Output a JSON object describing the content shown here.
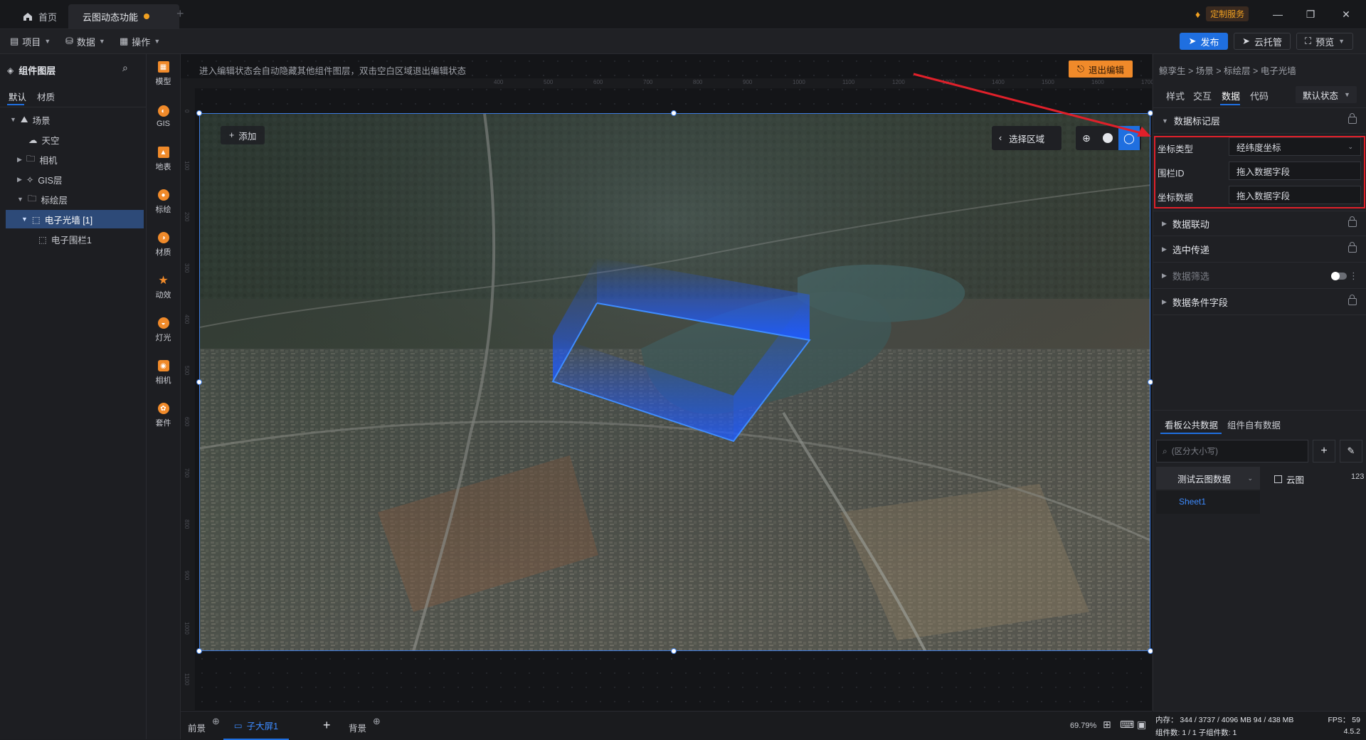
{
  "tabs": {
    "home": "首页",
    "current": "云图动态功能"
  },
  "premium": {
    "label": "定制服务"
  },
  "menu": {
    "project": "项目",
    "data": "数据",
    "operate": "操作"
  },
  "toolbar": {
    "publish": "发布",
    "cloud_host": "云托管",
    "preview": "预览"
  },
  "layers": {
    "title": "组件图层",
    "tabs": [
      "默认",
      "材质"
    ],
    "tree": [
      {
        "label": "场景"
      },
      {
        "label": "天空"
      },
      {
        "label": "相机"
      },
      {
        "label": "GIS层"
      },
      {
        "label": "标绘层"
      },
      {
        "label": "电子光墙 [1]"
      },
      {
        "label": "电子围栏1"
      }
    ]
  },
  "tools": [
    "模型",
    "GIS",
    "地表",
    "标绘",
    "材质",
    "动效",
    "灯光",
    "相机",
    "套件"
  ],
  "canvas": {
    "notice": "进入编辑状态会自动隐藏其他组件图层，双击空白区域退出编辑状态",
    "exit_edit": "退出编辑",
    "add": "添加",
    "select_area": "选择区域",
    "ruler_top": [
      "400",
      "500",
      "600",
      "700",
      "800",
      "900",
      "1000",
      "1100",
      "1200",
      "1300",
      "1400",
      "1500",
      "1600",
      "1700",
      "1800",
      "1900"
    ],
    "ruler_left": [
      "0",
      "100",
      "200",
      "300",
      "400",
      "500",
      "600",
      "700",
      "800",
      "900",
      "1000",
      "1100"
    ]
  },
  "props": {
    "breadcrumb": "鲸孪生 > 场景 > 标绘层 > 电子光墙",
    "tabs": [
      "样式",
      "交互",
      "数据",
      "代码"
    ],
    "state_select": "默认状态",
    "sections": {
      "data_markup": "数据标记层",
      "data_link": "数据联动",
      "selected_pass": "选中传递",
      "data_filter": "数据筛选",
      "data_condition": "数据条件字段"
    },
    "fields": [
      {
        "label": "坐标类型",
        "value": "经纬度坐标"
      },
      {
        "label": "围栏ID",
        "value": "拖入数据字段"
      },
      {
        "label": "坐标数据",
        "value": "拖入数据字段"
      }
    ],
    "data_tabs": [
      "看板公共数据",
      "组件自有数据"
    ],
    "search_placeholder": "(区分大小写)",
    "dataset": "测试云图数据",
    "dataset_item": "云图",
    "dataset_count": "123",
    "sheet": "Sheet1"
  },
  "bottom": {
    "foreground": "前景",
    "screen_tab": "子大屏1",
    "background": "背景",
    "zoom": "69.79%"
  },
  "status": {
    "memory": "内存： 344 / 3737 / 4096 MB  94 / 438 MB",
    "fps": "FPS： 59",
    "components": "组件数: 1 / 1   子组件数: 1",
    "version": "4.5.2"
  },
  "colors": {
    "accent": "#1f6fe0",
    "orange": "#f08a2a",
    "highlight_box": "#e0202a"
  }
}
